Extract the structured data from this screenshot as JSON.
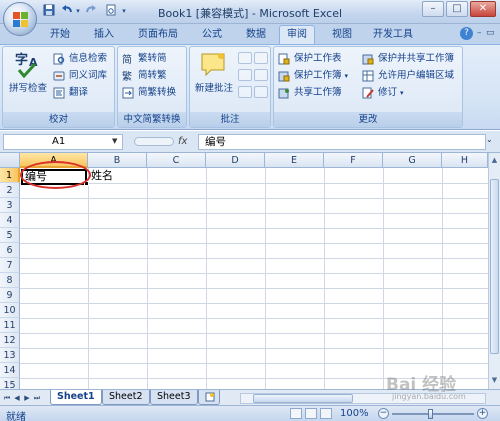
{
  "window": {
    "title": "Book1  [兼容模式] - Microsoft Excel",
    "controls": [
      "–",
      "□",
      "✕"
    ]
  },
  "quick_access": {
    "items": [
      "save-icon",
      "undo-icon",
      "redo-icon",
      "print-preview-icon",
      "customize-icon"
    ]
  },
  "tabs": [
    {
      "label": "开始"
    },
    {
      "label": "插入"
    },
    {
      "label": "页面布局"
    },
    {
      "label": "公式"
    },
    {
      "label": "数据"
    },
    {
      "label": "审阅",
      "active": true
    },
    {
      "label": "视图"
    },
    {
      "label": "开发工具"
    }
  ],
  "ribbon": {
    "groups": {
      "proofing": {
        "label": "校对",
        "spell_check": "拼写检查",
        "research": "信息检索",
        "thesaurus": "同义词库",
        "translate": "翻译"
      },
      "chinese": {
        "label": "中文简繁转换",
        "to_simplified": "繁转简",
        "to_traditional": "简转繁",
        "convert": "简繁转换"
      },
      "comments": {
        "label": "批注",
        "new_comment": "新建批注"
      },
      "changes": {
        "label": "更改",
        "protect_sheet": "保护工作表",
        "protect_workbook": "保护工作簿",
        "share_workbook": "共享工作簿",
        "protect_share": "保护并共享工作簿",
        "allow_edit": "允许用户编辑区域",
        "track_changes": "修订"
      }
    }
  },
  "formula_bar": {
    "name_box": "A1",
    "fx": "fx",
    "value": "编号"
  },
  "grid": {
    "columns": [
      "A",
      "B",
      "C",
      "D",
      "E",
      "F",
      "G",
      "H"
    ],
    "rows": [
      "1",
      "2",
      "3",
      "4",
      "5",
      "6",
      "7",
      "8",
      "9",
      "10",
      "11",
      "12",
      "13",
      "14",
      "15"
    ],
    "cells": {
      "A1": "编号",
      "B1": "姓名"
    }
  },
  "sheets": [
    {
      "label": "Sheet1",
      "active": true
    },
    {
      "label": "Sheet2"
    },
    {
      "label": "Sheet3"
    }
  ],
  "status": {
    "text": "就绪",
    "zoom": "100%"
  },
  "watermark": {
    "brand": "Bai 经验",
    "url": "jingyan.baidu.com"
  }
}
